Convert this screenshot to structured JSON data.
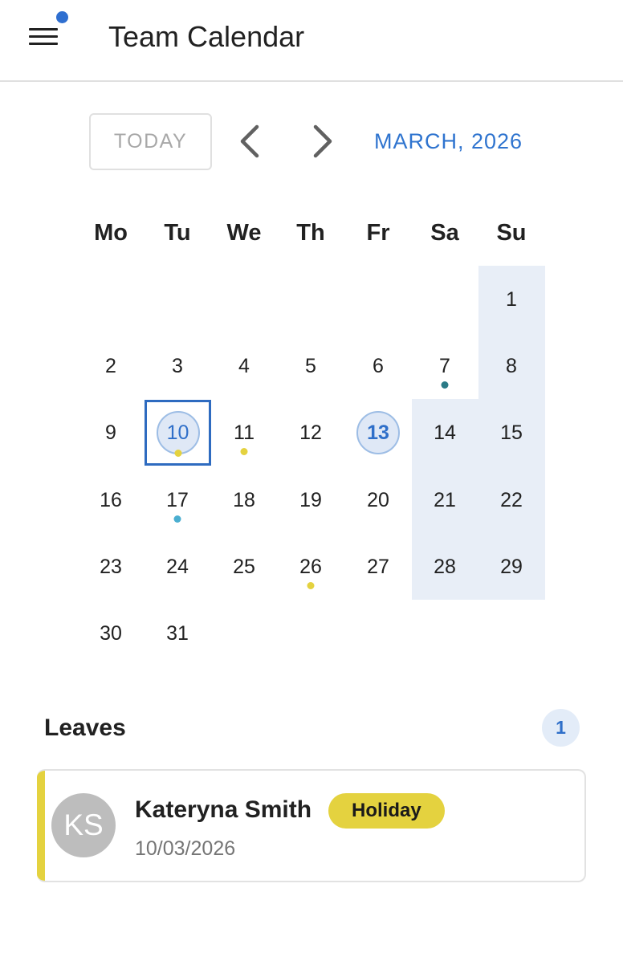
{
  "header": {
    "title": "Team Calendar"
  },
  "toolbar": {
    "today_label": "TODAY",
    "month_label": "MARCH, 2026"
  },
  "weekdays": [
    "Mo",
    "Tu",
    "We",
    "Th",
    "Fr",
    "Sa",
    "Su"
  ],
  "days": [
    "1",
    "2",
    "3",
    "4",
    "5",
    "6",
    "7",
    "8",
    "9",
    "10",
    "11",
    "12",
    "13",
    "14",
    "15",
    "16",
    "17",
    "18",
    "19",
    "20",
    "21",
    "22",
    "23",
    "24",
    "25",
    "26",
    "27",
    "28",
    "29",
    "30",
    "31"
  ],
  "colors": {
    "accent": "#2f74cf",
    "weekend": "#e8eef7",
    "holiday": "#e4d23f",
    "dot_teal": "#2a7a86",
    "dot_cyan": "#4aaed0",
    "dot_yellow": "#e4d23f"
  },
  "leaves": {
    "title": "Leaves",
    "count": "1",
    "items": [
      {
        "initials": "KS",
        "name": "Kateryna Smith",
        "type": "Holiday",
        "date": "10/03/2026"
      }
    ]
  }
}
